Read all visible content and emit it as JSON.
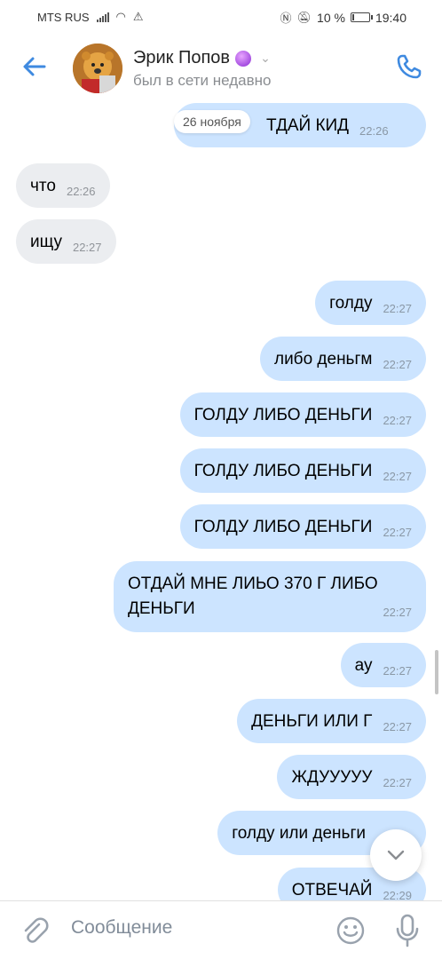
{
  "status": {
    "carrier": "MTS RUS",
    "battery": "10 %",
    "time": "19:40"
  },
  "header": {
    "name": "Эрик Попов",
    "subtitle": "был в сети недавно"
  },
  "chat": {
    "date_pill": "26 ноября",
    "messages": [
      {
        "text": "ТДАЙ КИД",
        "time": "22:26",
        "dir": "out"
      },
      {
        "text": "что",
        "time": "22:26",
        "dir": "in"
      },
      {
        "text": "ищу",
        "time": "22:27",
        "dir": "in"
      },
      {
        "text": "голду",
        "time": "22:27",
        "dir": "out"
      },
      {
        "text": "либо деньгм",
        "time": "22:27",
        "dir": "out"
      },
      {
        "text": "ГОЛДУ ЛИБО ДЕНЬГИ",
        "time": "22:27",
        "dir": "out"
      },
      {
        "text": "ГОЛДУ ЛИБО ДЕНЬГИ",
        "time": "22:27",
        "dir": "out"
      },
      {
        "text": "ГОЛДУ ЛИБО ДЕНЬГИ",
        "time": "22:27",
        "dir": "out"
      },
      {
        "text": "ОТДАЙ МНЕ ЛИЬО 370 Г ЛИБО ДЕНЬГИ",
        "time": "22:27",
        "dir": "out"
      },
      {
        "text": "ау",
        "time": "22:27",
        "dir": "out"
      },
      {
        "text": "ДЕНЬГИ ИЛИ Г",
        "time": "22:27",
        "dir": "out"
      },
      {
        "text": "ЖДУУУУУ",
        "time": "22:27",
        "dir": "out"
      },
      {
        "text": "голду или деньги",
        "time": "",
        "dir": "out"
      },
      {
        "text": "ОТВЕЧАЙ",
        "time": "22:29",
        "dir": "out"
      }
    ]
  },
  "composer": {
    "placeholder": "Сообщение"
  },
  "colors": {
    "accent": "#3f8ae0",
    "outgoing_bubble": "#cce4ff",
    "incoming_bubble": "#ebedf0"
  },
  "icons": [
    "back-arrow-icon",
    "phone-icon",
    "chevron-down-icon",
    "paperclip-icon",
    "smile-icon",
    "microphone-icon",
    "scroll-down-icon"
  ]
}
